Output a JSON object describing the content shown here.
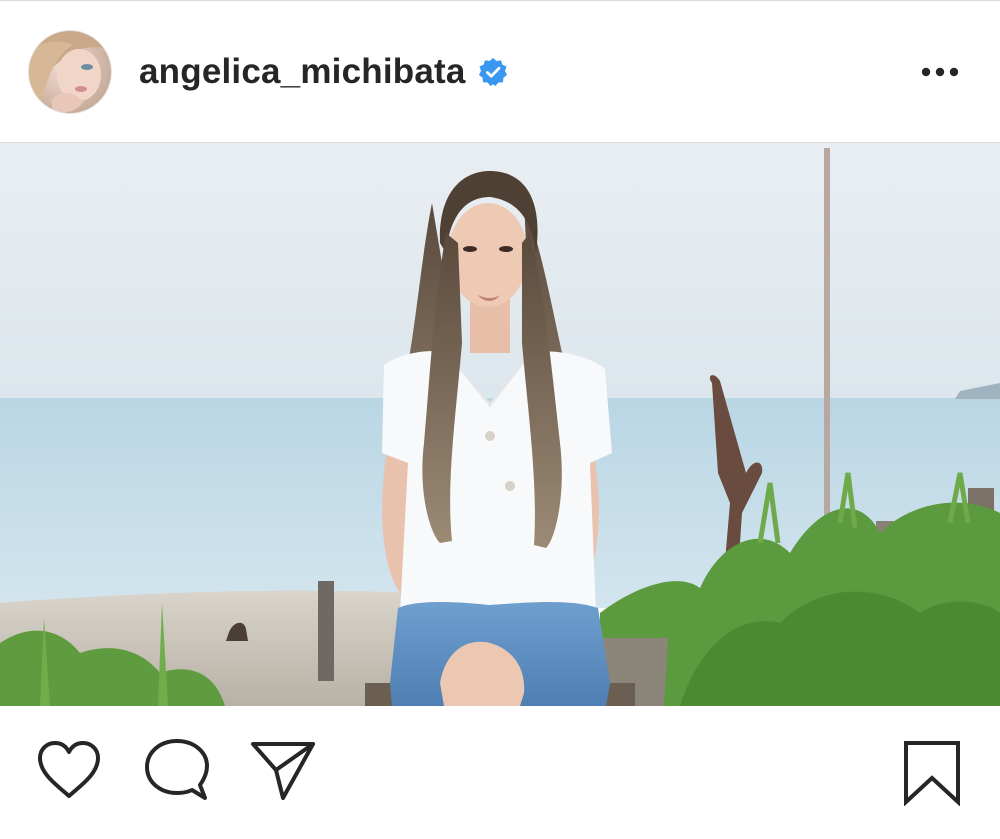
{
  "post": {
    "username": "angelica_michibata",
    "verified": true,
    "accent_color": "#3897f0"
  },
  "header": {
    "avatar_icon": "profile-avatar",
    "verified_icon": "verified-badge-icon",
    "more_icon": "more-options-icon"
  },
  "actions": {
    "like_icon": "heart-icon",
    "comment_icon": "comment-icon",
    "share_icon": "paper-plane-icon",
    "save_icon": "bookmark-icon"
  }
}
